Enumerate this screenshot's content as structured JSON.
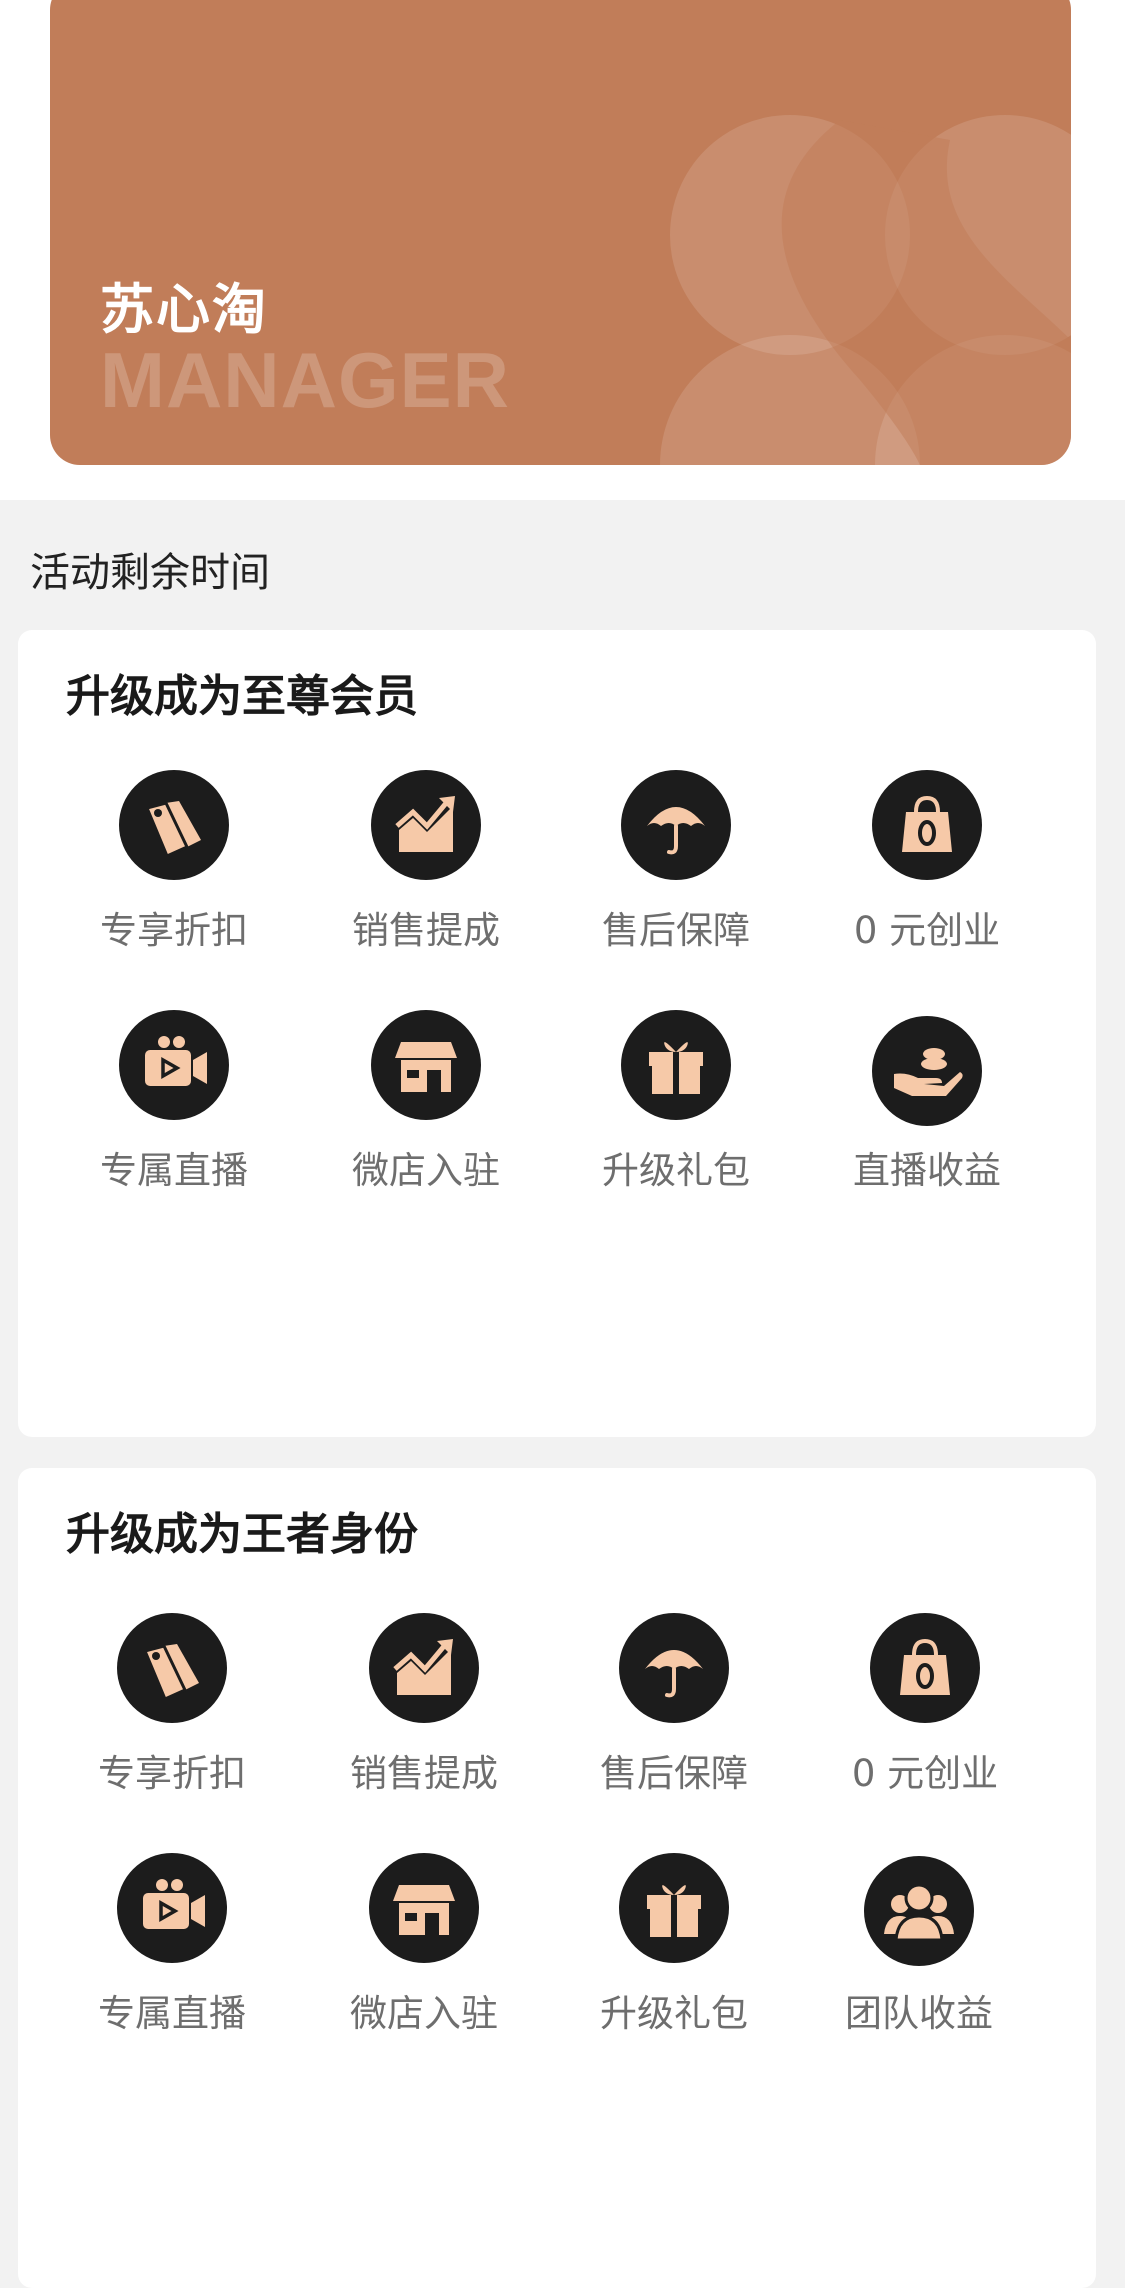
{
  "card": {
    "title": "苏心淘",
    "subtitle": "MANAGER",
    "color": "#c17d59"
  },
  "countdown_label": "活动剩余时间",
  "sections": [
    {
      "title": "升级成为至尊会员",
      "benefits": [
        {
          "label": "专享折扣",
          "icon": "price-tags-icon"
        },
        {
          "label": "销售提成",
          "icon": "growth-chart-icon"
        },
        {
          "label": "售后保障",
          "icon": "umbrella-icon"
        },
        {
          "label": "0 元创业",
          "icon": "zero-bag-icon"
        },
        {
          "label": "专属直播",
          "icon": "video-camera-icon"
        },
        {
          "label": "微店入驻",
          "icon": "shop-icon"
        },
        {
          "label": "升级礼包",
          "icon": "gift-icon"
        },
        {
          "label": "直播收益",
          "icon": "hand-coins-icon"
        }
      ]
    },
    {
      "title": "升级成为王者身份",
      "benefits": [
        {
          "label": "专享折扣",
          "icon": "price-tags-icon"
        },
        {
          "label": "销售提成",
          "icon": "growth-chart-icon"
        },
        {
          "label": "售后保障",
          "icon": "umbrella-icon"
        },
        {
          "label": "0 元创业",
          "icon": "zero-bag-icon"
        },
        {
          "label": "专属直播",
          "icon": "video-camera-icon"
        },
        {
          "label": "微店入驻",
          "icon": "shop-icon"
        },
        {
          "label": "升级礼包",
          "icon": "gift-icon"
        },
        {
          "label": "团队收益",
          "icon": "team-icon"
        }
      ]
    }
  ],
  "colors": {
    "icon_background": "#1c1c1c",
    "icon_glyph": "#f6c9a8",
    "label": "#6e6e6e"
  }
}
